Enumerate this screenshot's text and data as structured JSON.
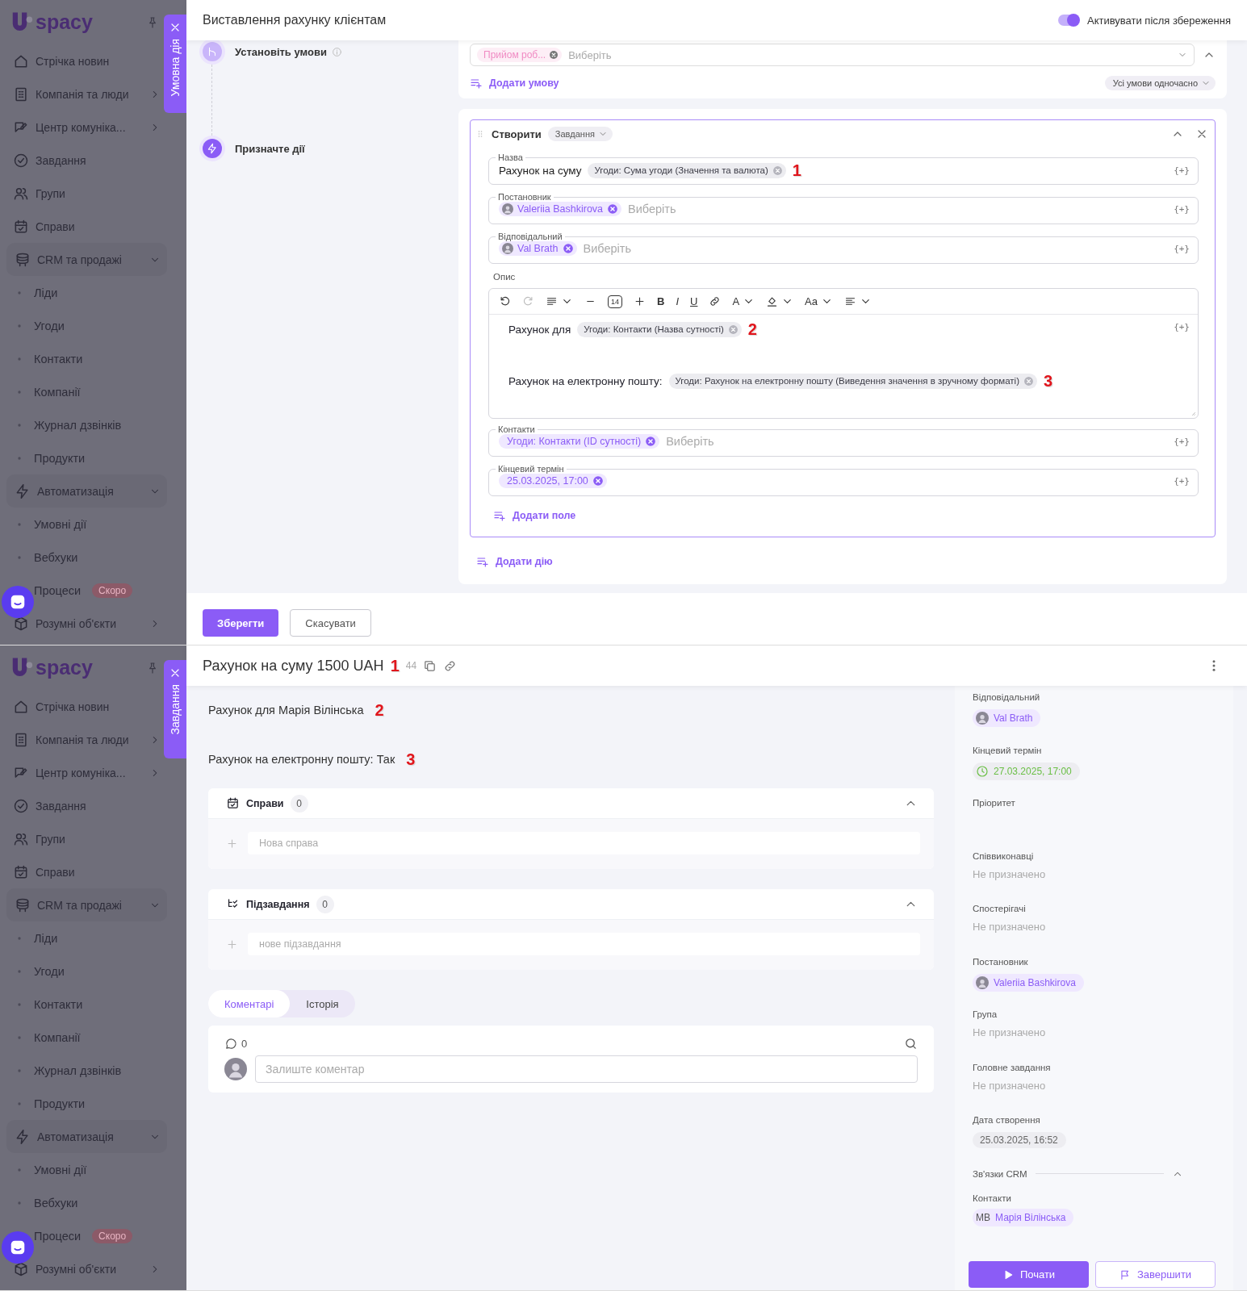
{
  "automation": {
    "sidebar": {
      "logo": "spacy",
      "items": [
        {
          "kind": "link",
          "label": "Стрічка новин",
          "has_submenu": false
        },
        {
          "kind": "link",
          "label": "Компанія та люди",
          "has_submenu": true
        },
        {
          "kind": "link",
          "label": "Центр комуніка...",
          "has_submenu": true
        },
        {
          "kind": "link",
          "label": "Завдання",
          "has_submenu": false
        },
        {
          "kind": "link",
          "label": "Групи",
          "has_submenu": false
        },
        {
          "kind": "link",
          "label": "Справи",
          "has_submenu": false
        },
        {
          "kind": "group",
          "label": "CRM та продажі",
          "expanded": true,
          "children": [
            {
              "label": "Ліди"
            },
            {
              "label": "Угоди"
            },
            {
              "label": "Контакти"
            },
            {
              "label": "Компанії"
            },
            {
              "label": "Журнал дзвінків"
            },
            {
              "label": "Продукти"
            }
          ]
        },
        {
          "kind": "group",
          "label": "Автоматизація",
          "expanded": true,
          "children": [
            {
              "label": "Умовні дії"
            },
            {
              "label": "Вебхуки"
            },
            {
              "label": "Процеси",
              "badge": "Скоро"
            }
          ]
        },
        {
          "kind": "link",
          "label": "Розумні об'єкти",
          "has_submenu": true
        }
      ]
    },
    "side_tab": "Умовна дія",
    "title": "Виставлення рахунку клієнтам",
    "activate_toggle": {
      "label": "Активувати після збереження",
      "on": true
    },
    "steps": [
      {
        "kind": "conditions",
        "label": "Установіть умови"
      },
      {
        "kind": "actions",
        "label": "Призначте дії"
      }
    ],
    "condition_card": {
      "chip": "Прийом роб...",
      "placeholder": "Виберіть",
      "add_link": "Додати умову",
      "mode": "Усі умови одночасно"
    },
    "action_card": {
      "verb": "Створити",
      "entity": "Завдання",
      "fields": [
        {
          "kind": "text",
          "label": "Назва",
          "value": "Рахунок на суму",
          "tokens": [
            "Угоди: Сума угоди (Значення та валюта)"
          ],
          "annotation": "1",
          "insert": "{+}"
        },
        {
          "kind": "user",
          "label": "Постановник",
          "tokens": [
            "Valeriia Bashkirova"
          ],
          "placeholder": "Виберіть",
          "insert": "{+}"
        },
        {
          "kind": "user",
          "label": "Відповідальний",
          "tokens": [
            "Val Brath"
          ],
          "placeholder": "Виберіть",
          "insert": "{+}"
        },
        {
          "kind": "editor",
          "label": "Опис",
          "insert": "{+}",
          "toolbar": [
            {
              "kind": "undo",
              "disabled": false,
              "dropdown": false
            },
            {
              "kind": "redo",
              "disabled": true,
              "dropdown": false
            },
            {
              "kind": "list",
              "disabled": false,
              "dropdown": true
            },
            {
              "kind": "minus",
              "disabled": false,
              "dropdown": false
            },
            {
              "kind": "size",
              "label": "14",
              "disabled": false,
              "dropdown": false
            },
            {
              "kind": "plus",
              "disabled": false,
              "dropdown": false
            },
            {
              "kind": "bold",
              "label": "B",
              "disabled": false,
              "dropdown": false
            },
            {
              "kind": "italic",
              "label": "I",
              "disabled": false,
              "dropdown": false
            },
            {
              "kind": "underline",
              "label": "U",
              "disabled": false,
              "dropdown": false
            },
            {
              "kind": "link",
              "disabled": false,
              "dropdown": false
            },
            {
              "kind": "color",
              "label": "A",
              "disabled": false,
              "dropdown": true
            },
            {
              "kind": "fill",
              "disabled": false,
              "dropdown": true
            },
            {
              "kind": "case",
              "label": "Aa",
              "disabled": false,
              "dropdown": true
            },
            {
              "kind": "align",
              "disabled": false,
              "dropdown": true
            }
          ],
          "lines": [
            {
              "text": "Рахунок для",
              "token": "Угоди: Контакти (Назва сутності)",
              "annotation": "2"
            },
            {
              "text": "Рахунок на електронну пошту:",
              "token": "Угоди: Рахунок на електронну пошту (Виведення значення в зручному форматі)",
              "annotation": "3"
            }
          ]
        },
        {
          "kind": "select",
          "label": "Контакти",
          "tokens": [
            "Угоди: Контакти (ID сутності)"
          ],
          "placeholder": "Виберіть",
          "insert": "{+}"
        },
        {
          "kind": "select",
          "label": "Кінцевий термін",
          "tokens": [
            "25.03.2025, 17:00"
          ],
          "insert": "{+}"
        }
      ],
      "add_field": "Додати поле",
      "add_action": "Додати дію"
    },
    "buttons": [
      {
        "kind": "primary",
        "label": "Зберегти"
      },
      {
        "kind": "secondary",
        "label": "Скасувати"
      }
    ]
  },
  "task": {
    "sidebar": {
      "logo": "spacy",
      "items": [
        {
          "kind": "link",
          "label": "Стрічка новин",
          "has_submenu": false
        },
        {
          "kind": "link",
          "label": "Компанія та люди",
          "has_submenu": true
        },
        {
          "kind": "link",
          "label": "Центр комуніка...",
          "has_submenu": true
        },
        {
          "kind": "link",
          "label": "Завдання",
          "has_submenu": false
        },
        {
          "kind": "link",
          "label": "Групи",
          "has_submenu": false
        },
        {
          "kind": "link",
          "label": "Справи",
          "has_submenu": false
        },
        {
          "kind": "group",
          "label": "CRM та продажі",
          "expanded": true,
          "children": [
            {
              "label": "Ліди"
            },
            {
              "label": "Угоди"
            },
            {
              "label": "Контакти"
            },
            {
              "label": "Компанії"
            },
            {
              "label": "Журнал дзвінків"
            },
            {
              "label": "Продукти"
            }
          ]
        },
        {
          "kind": "group",
          "label": "Автоматизація",
          "expanded": true,
          "children": [
            {
              "label": "Умовні дії"
            },
            {
              "label": "Вебхуки"
            },
            {
              "label": "Процеси",
              "badge": "Скоро"
            }
          ]
        },
        {
          "kind": "link",
          "label": "Розумні об'єкти",
          "has_submenu": true
        }
      ]
    },
    "side_tab": "Завдання",
    "title": "Рахунок на суму 1500 UAH",
    "title_annotation": "1",
    "number": "44",
    "description": [
      {
        "text": "Рахунок для Марія Вілінська",
        "annotation": "2"
      },
      {
        "text": "Рахунок на електронну пошту: Так",
        "annotation": "3"
      }
    ],
    "sections": [
      {
        "kind": "activities",
        "title": "Справи",
        "count": "0",
        "placeholder": "Нова справа",
        "expanded": true
      },
      {
        "kind": "subtasks",
        "title": "Підзавдання",
        "count": "0",
        "placeholder": "нове підзавдання",
        "expanded": true
      }
    ],
    "tabs": [
      {
        "label": "Коментарі",
        "selected": true
      },
      {
        "label": "Історія",
        "selected": false
      }
    ],
    "comments": {
      "count": "0",
      "placeholder": "Залиште коментар"
    },
    "details": [
      {
        "kind": "user",
        "label": "Відповідальний",
        "value": "Val Brath"
      },
      {
        "kind": "deadline",
        "label": "Кінцевий термін",
        "value": "27.03.2025, 17:00"
      },
      {
        "kind": "empty",
        "label": "Пріоритет"
      },
      {
        "kind": "unassigned",
        "label": "Співвиконавці",
        "value": "Не призначено"
      },
      {
        "kind": "unassigned",
        "label": "Спостерігачі",
        "value": "Не призначено"
      },
      {
        "kind": "user",
        "label": "Постановник",
        "value": "Valeriia Bashkirova"
      },
      {
        "kind": "unassigned",
        "label": "Група",
        "value": "Не призначено"
      },
      {
        "kind": "unassigned",
        "label": "Головне завдання",
        "value": "Не призначено"
      },
      {
        "kind": "date",
        "label": "Дата створення",
        "value": "25.03.2025, 16:52"
      }
    ],
    "crm": {
      "title": "Зв'язки CRM",
      "expanded": true,
      "label": "Контакти",
      "initials": "МВ",
      "name": "Марія Вілінська"
    },
    "buttons": [
      {
        "kind": "start",
        "label": "Почати"
      },
      {
        "kind": "finish",
        "label": "Завершити"
      }
    ]
  }
}
